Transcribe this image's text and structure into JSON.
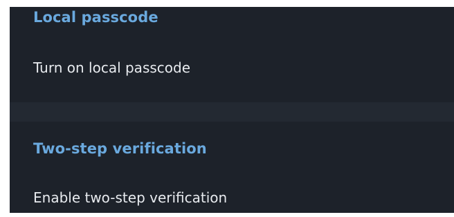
{
  "sections": [
    {
      "title": "Local passcode",
      "items": [
        {
          "label": "Turn on local passcode"
        }
      ]
    },
    {
      "title": "Two-step verification",
      "items": [
        {
          "label": "Enable two-step verification"
        }
      ]
    }
  ],
  "colors": {
    "panel_background": "#1d222a",
    "separator": "#232932",
    "section_title": "#6aa9de",
    "item_text": "#e8ebef",
    "outer_background": "#ffffff"
  }
}
